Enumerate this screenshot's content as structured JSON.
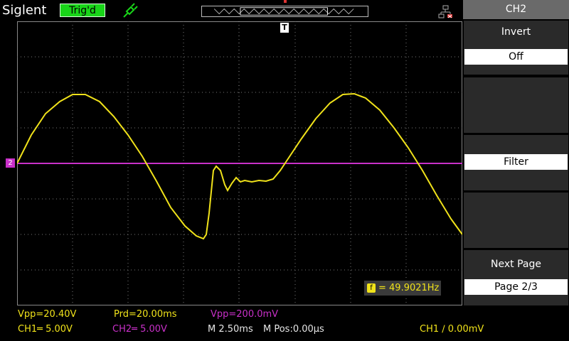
{
  "header": {
    "brand": "Siglent",
    "trigger_status": "Trig'd",
    "icons": [
      "probe-icon",
      "network-icon"
    ],
    "colors": {
      "trig_bg": "#19d519",
      "ch1": "#f0e21a",
      "ch2": "#c930c9"
    }
  },
  "markers": {
    "trigger_pos": "T",
    "ch2_ground": "2"
  },
  "measure": {
    "freq_icon": "f",
    "freq": "= 49.9021Hz"
  },
  "sidebar": {
    "title": "CH2",
    "items": [
      {
        "label": "Invert",
        "value": "Off"
      },
      {
        "label": "Filter",
        "value": ""
      },
      {
        "label": "",
        "value": ""
      },
      {
        "label": "Next Page",
        "value": "Page 2/3"
      }
    ]
  },
  "status": {
    "vpp1": "Vpp=20.40V",
    "prd": "Prd=20.00ms",
    "vpp2": "Vpp=200.0mV",
    "ch1": "CH1═ 5.00V",
    "ch2": "CH2═ 5.00V",
    "timebase": "M 2.50ms",
    "mpos": "M Pos:0.00µs",
    "trig": "CH1 ∕ 0.00mV"
  }
}
